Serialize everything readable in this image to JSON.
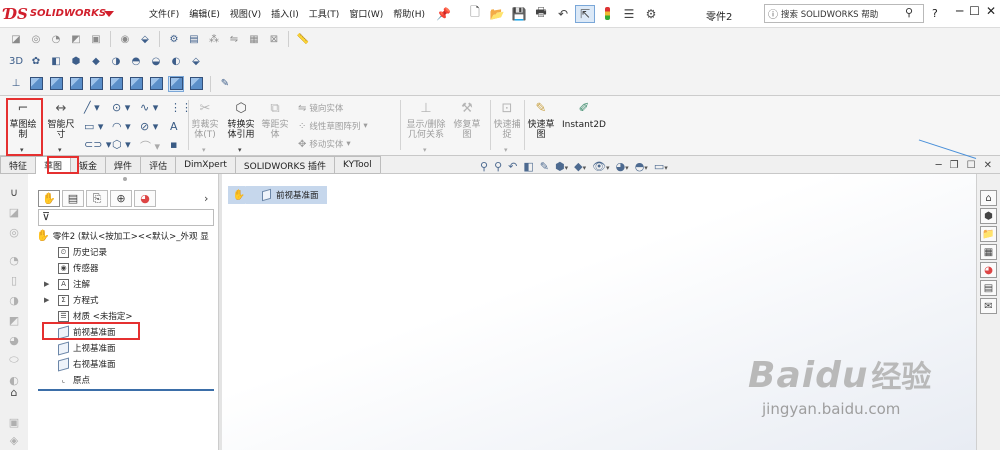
{
  "app": {
    "logo_mark": "ƊS",
    "logo_text": "SOLIDWORKS",
    "document_title": "零件2"
  },
  "menu": [
    "文件(F)",
    "编辑(E)",
    "视图(V)",
    "插入(I)",
    "工具(T)",
    "窗口(W)",
    "帮助(H)"
  ],
  "search": {
    "placeholder": "搜索 SOLIDWORKS 帮助"
  },
  "ribbon": {
    "sketch": "草图绘\n制",
    "smart_dim": "智能尺\n寸",
    "trim": "剪裁实\n体(T)",
    "convert": "转换实\n体引用",
    "offset": "等距实\n体",
    "mirror": "镜向实体",
    "linear_pattern": "线性草图阵列",
    "move": "移动实体",
    "display_delete": "显示/删除\n几何关系",
    "repair": "修复草\n图",
    "quick_snap": "快速捕\n捉",
    "rapid_sketch": "快速草\n图",
    "instant2d": "Instant2D"
  },
  "tabs": [
    "特征",
    "草图",
    "钣金",
    "焊件",
    "评估",
    "DimXpert",
    "SOLIDWORKS 插件",
    "KYTool"
  ],
  "feature_tree": {
    "root": "零件2 (默认<按加工><<默认>_外观 显",
    "items": [
      "历史记录",
      "传感器",
      "注解",
      "方程式",
      "材质 <未指定>",
      "前视基准面",
      "上视基准面",
      "右视基准面",
      "原点"
    ]
  },
  "breadcrumb": {
    "label": "前视基准面"
  },
  "watermark": {
    "logo": "Bai",
    "paw": "du",
    "cn": "经验",
    "url": "jingyan.baidu.com"
  },
  "colors": {
    "brand": "#d11f2c",
    "highlight": "#e53030",
    "accent": "#3b6ea8"
  }
}
